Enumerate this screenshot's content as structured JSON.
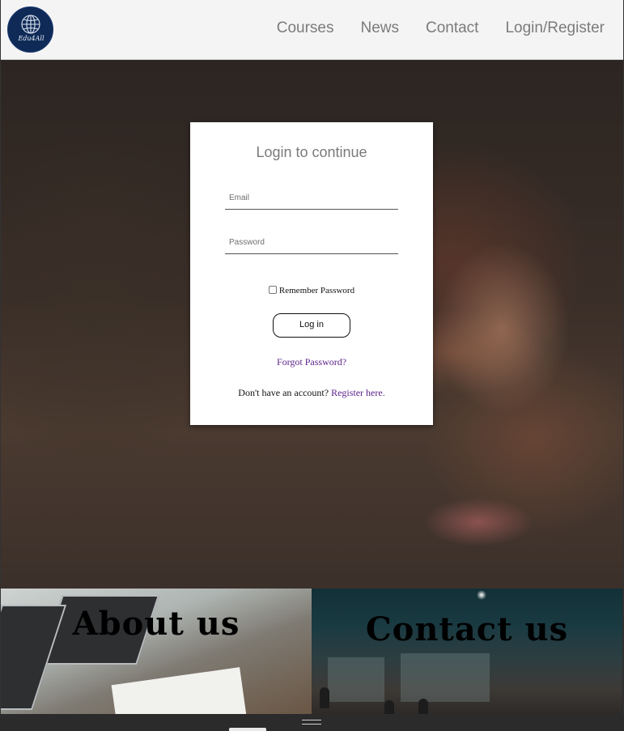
{
  "header": {
    "logo_text": "Edu4All",
    "nav": [
      "Courses",
      "News",
      "Contact",
      "Login/Register"
    ]
  },
  "login": {
    "title": "Login to continue",
    "email_placeholder": "Email",
    "password_placeholder": "Password",
    "remember_label": "Remember Password",
    "remember_checked": false,
    "login_button": "Log in",
    "forgot_link": "Forgot Password?",
    "register_prompt": "Don't have an account?",
    "register_link": "Register here."
  },
  "tiles": {
    "about": "About us",
    "contact": "Contact us"
  },
  "icons": {
    "logo": "globe-icon",
    "bottom_handle": "drag-handle-icon"
  },
  "colors": {
    "header_bg": "#f4f4f4",
    "nav_text": "#7b7b7b",
    "logo_bg": "#0f2a57",
    "link": "#5a1f8a"
  }
}
